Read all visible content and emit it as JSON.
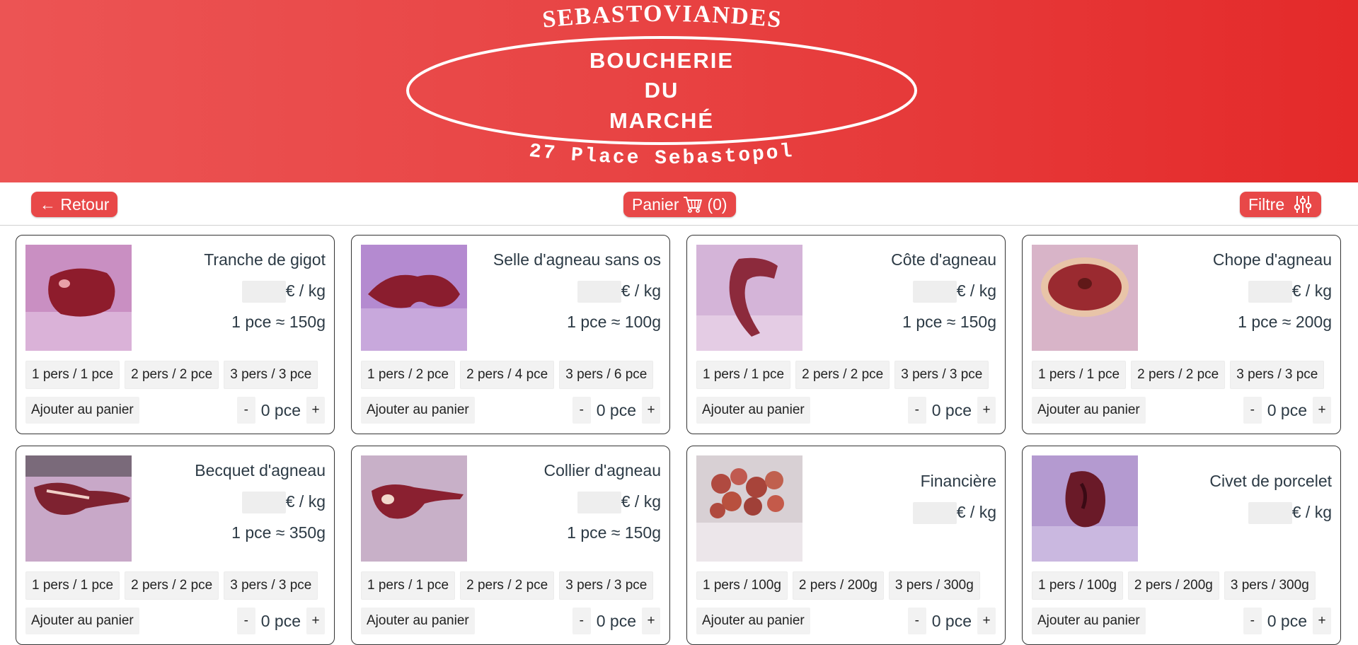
{
  "banner": {
    "top_arc": "SEBASTOVIANDES",
    "line1": "BOUCHERIE",
    "line2": "DU",
    "line3": "MARCHÉ",
    "bottom_arc": "27 Place Sebastopol"
  },
  "toolbar": {
    "back_label": "← Retour",
    "cart_label": "Panier",
    "cart_count": "(0)",
    "filter_label": "Filtre"
  },
  "colors": {
    "brand": "#e84848",
    "banner_left": "#ec5454",
    "banner_right": "#e42a2a"
  },
  "products": [
    {
      "name": "Tranche de gigot",
      "price_unit": "€ / kg",
      "weight": "1 pce ≈ 150g",
      "options": [
        "1 pers / 1 pce",
        "2 pers / 2 pce",
        "3 pers / 3 pce"
      ],
      "add_label": "Ajouter au panier",
      "minus": "-",
      "qty": "0 pce",
      "plus": "+",
      "image": "lamb-leg-slice"
    },
    {
      "name": "Selle d'agneau sans os",
      "price_unit": "€ / kg",
      "weight": "1 pce ≈ 100g",
      "options": [
        "1 pers / 2 pce",
        "2 pers / 4 pce",
        "3 pers / 6 pce"
      ],
      "add_label": "Ajouter au panier",
      "minus": "-",
      "qty": "0 pce",
      "plus": "+",
      "image": "boneless-lamb-saddle"
    },
    {
      "name": "Côte d'agneau",
      "price_unit": "€ / kg",
      "weight": "1 pce ≈ 150g",
      "options": [
        "1 pers / 1 pce",
        "2 pers / 2 pce",
        "3 pers / 3 pce"
      ],
      "add_label": "Ajouter au panier",
      "minus": "-",
      "qty": "0 pce",
      "plus": "+",
      "image": "lamb-rib"
    },
    {
      "name": "Chope d'agneau",
      "price_unit": "€ / kg",
      "weight": "1 pce ≈ 200g",
      "options": [
        "1 pers / 1 pce",
        "2 pers / 2 pce",
        "3 pers / 3 pce"
      ],
      "add_label": "Ajouter au panier",
      "minus": "-",
      "qty": "0 pce",
      "plus": "+",
      "image": "lamb-chop"
    },
    {
      "name": "Becquet d'agneau",
      "price_unit": "€ / kg",
      "weight": "1 pce ≈ 350g",
      "options": [
        "1 pers / 1 pce",
        "2 pers / 2 pce",
        "3 pers / 3 pce"
      ],
      "add_label": "Ajouter au panier",
      "minus": "-",
      "qty": "0 pce",
      "plus": "+",
      "image": "lamb-shoulder"
    },
    {
      "name": "Collier d'agneau",
      "price_unit": "€ / kg",
      "weight": "1 pce ≈ 150g",
      "options": [
        "1 pers / 1 pce",
        "2 pers / 2 pce",
        "3 pers / 3 pce"
      ],
      "add_label": "Ajouter au panier",
      "minus": "-",
      "qty": "0 pce",
      "plus": "+",
      "image": "lamb-neck"
    },
    {
      "name": "Financière",
      "price_unit": "€ / kg",
      "weight": "",
      "options": [
        "1 pers / 100g",
        "2 pers / 200g",
        "3 pers / 300g"
      ],
      "add_label": "Ajouter au panier",
      "minus": "-",
      "qty": "0 pce",
      "plus": "+",
      "image": "financiere-pieces"
    },
    {
      "name": "Civet de porcelet",
      "price_unit": "€ / kg",
      "weight": "",
      "options": [
        "1 pers / 100g",
        "2 pers / 200g",
        "3 pers / 300g"
      ],
      "add_label": "Ajouter au panier",
      "minus": "-",
      "qty": "0 pce",
      "plus": "+",
      "image": "piglet-stew-meat"
    }
  ]
}
